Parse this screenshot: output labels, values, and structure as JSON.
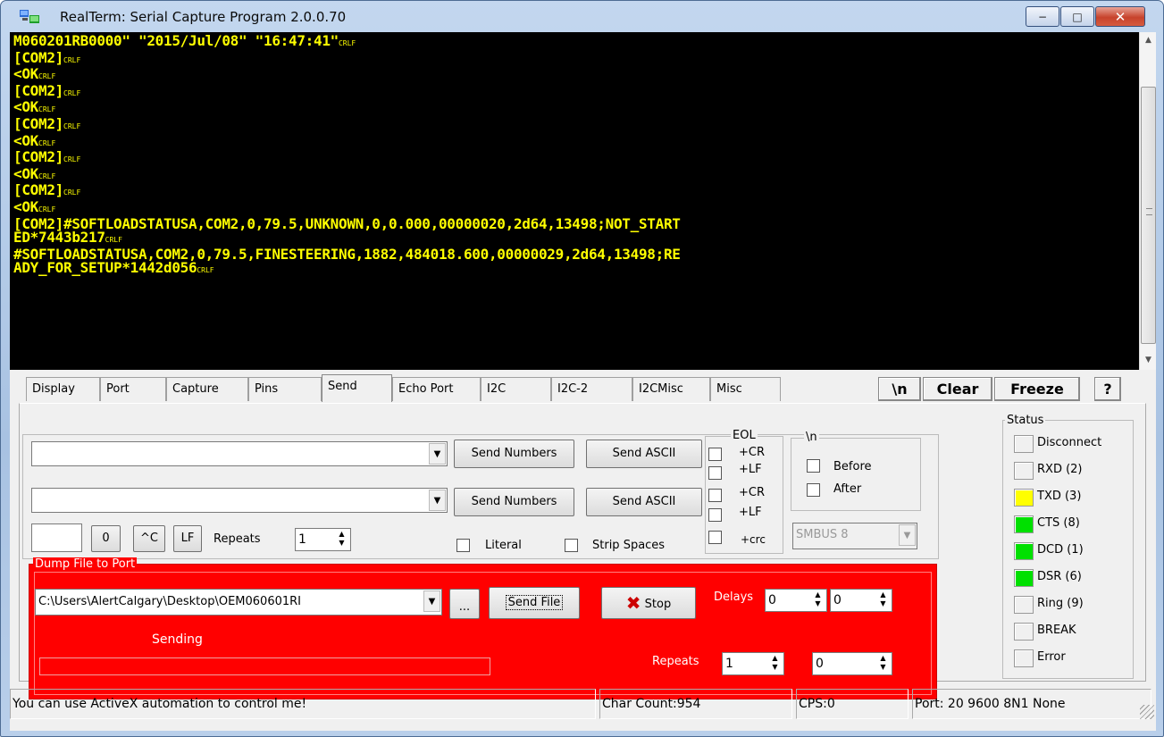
{
  "window": {
    "title": "RealTerm: Serial Capture Program 2.0.0.70",
    "min_label": "−",
    "max_label": "□",
    "close_label": "✕"
  },
  "terminal": {
    "lines": [
      "M060201RB0000\" \"2015/Jul/08\" \"16:47:41\"",
      "[COM2]",
      "<OK",
      "[COM2]",
      "<OK",
      "[COM2]",
      "<OK",
      "[COM2]",
      "<OK",
      "[COM2]",
      "<OK",
      "[COM2]#SOFTLOADSTATUSA,COM2,0,79.5,UNKNOWN,0,0.000,00000020,2d64,13498;NOT_START",
      "ED*7443b217",
      "#SOFTLOADSTATUSA,COM2,0,79.5,FINESTEERING,1882,484018.600,00000029,2d64,13498;RE",
      "ADY_FOR_SETUP*1442d056"
    ],
    "crlf_marker": "CRLF",
    "text_color": "#ffff00",
    "background": "#000000"
  },
  "tabs": [
    "Display",
    "Port",
    "Capture",
    "Pins",
    "Send",
    "Echo Port",
    "I2C",
    "I2C-2",
    "I2CMisc",
    "Misc"
  ],
  "active_tab": "Send",
  "toolbar": {
    "newline_label": "\\n",
    "clear_label": "Clear",
    "freeze_label": "Freeze",
    "help_label": "?"
  },
  "send": {
    "row1": {
      "value": "",
      "numbers_label": "Send Numbers",
      "ascii_label": "Send ASCII"
    },
    "row2": {
      "value": "",
      "numbers_label": "Send Numbers",
      "ascii_label": "Send ASCII"
    },
    "small_value": "",
    "zero_label": "0",
    "ctrlc_label": "^C",
    "lf_label": "LF",
    "repeats_label": "Repeats",
    "repeats_value": "1",
    "literal_label": "Literal",
    "strip_spaces_label": "Strip Spaces"
  },
  "eol": {
    "title": "EOL",
    "items": [
      "+CR",
      "+LF",
      "+CR",
      "+LF",
      "+crc"
    ]
  },
  "newline_group": {
    "title": "\\n",
    "before_label": "Before",
    "after_label": "After"
  },
  "smbus": {
    "value": "SMBUS 8"
  },
  "dump": {
    "title": "Dump File to Port",
    "file_path": "C:\\Users\\AlertCalgary\\Desktop\\OEM060601RI",
    "browse_label": "...",
    "send_file_label": "Send File",
    "stop_label": "Stop",
    "delays_label": "Delays",
    "delay1": "0",
    "delay2": "0",
    "sending_label": "Sending",
    "progress": 0,
    "repeats_label": "Repeats",
    "repeats1": "1",
    "repeats2": "0"
  },
  "status": {
    "title": "Status",
    "items": [
      {
        "label": "Disconnect",
        "color": "#f0f0f0"
      },
      {
        "label": "RXD (2)",
        "color": "#f0f0f0"
      },
      {
        "label": "TXD (3)",
        "color": "#ffff00"
      },
      {
        "label": "CTS (8)",
        "color": "#00e000"
      },
      {
        "label": "DCD (1)",
        "color": "#00e000"
      },
      {
        "label": "DSR (6)",
        "color": "#00e000"
      },
      {
        "label": "Ring (9)",
        "color": "#f0f0f0"
      },
      {
        "label": "BREAK",
        "color": "#f0f0f0"
      },
      {
        "label": "Error",
        "color": "#f0f0f0"
      }
    ]
  },
  "statusbar": {
    "message": "You can use ActiveX automation to control me!",
    "char_count": "Char Count:954",
    "cps": "CPS:0",
    "port": "Port: 20 9600 8N1 None"
  }
}
